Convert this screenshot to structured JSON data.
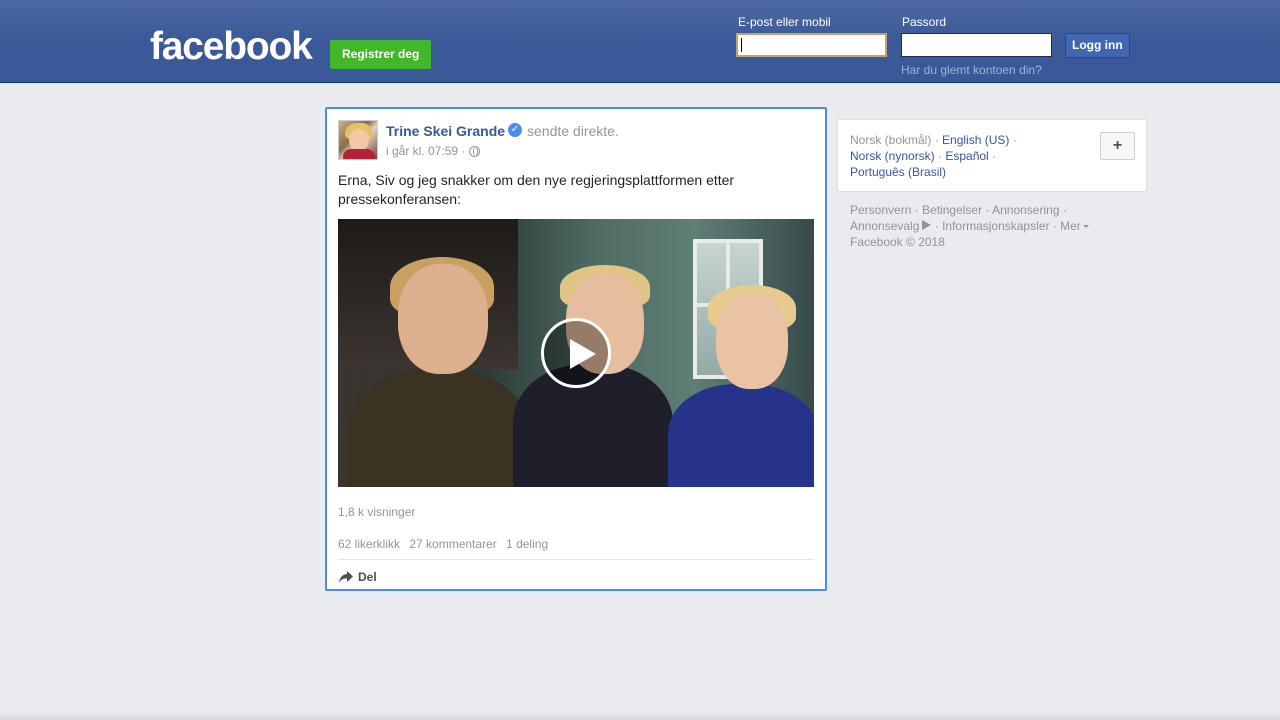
{
  "header": {
    "logo": "facebook",
    "register_label": "Registrer deg",
    "email_label": "E-post eller mobil",
    "email_value": "",
    "password_label": "Passord",
    "password_value": "",
    "login_label": "Logg inn",
    "forgot_label": "Har du glemt kontoen din?"
  },
  "post": {
    "author": "Trine Skei Grande",
    "action": "sendte direkte.",
    "timestamp": "i går kl. 07:59 ·",
    "text": "Erna, Siv og jeg snakker om den nye regjeringsplattformen etter pressekonferansen:",
    "views": "1,8 k visninger",
    "likes": "62 likerklikk",
    "comments": "27 kommentarer",
    "shares": "1 deling",
    "share_label": "Del"
  },
  "languages": {
    "current": "Norsk (bokmål)",
    "items": [
      "English (US)",
      "Norsk (nynorsk)",
      "Español",
      "Português (Brasil)"
    ],
    "add_label": "+"
  },
  "footer": {
    "links": [
      "Personvern",
      "Betingelser",
      "Annonsering",
      "Annonsevalg",
      "Informasjonskapsler",
      "Mer"
    ],
    "copyright": "Facebook © 2018"
  },
  "colors": {
    "header_bg": "#3b5998",
    "register_green": "#42b72a",
    "link_blue": "#365899",
    "post_focus_border": "#4f8be5",
    "page_bg": "#e9ebee"
  }
}
